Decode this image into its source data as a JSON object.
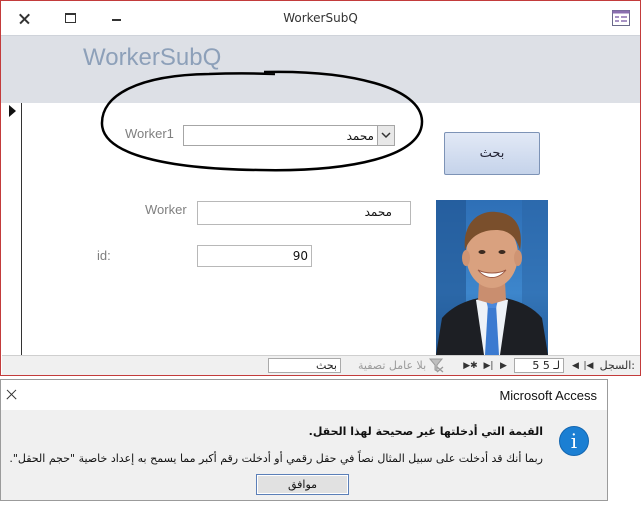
{
  "window": {
    "title": "WorkerSubQ"
  },
  "form": {
    "header_title": "WorkerSubQ",
    "worker1_label": "Worker1",
    "worker1_value": "محمد",
    "search_button": "بحث",
    "worker_label": "Worker",
    "worker_value": "محمد",
    "id_label": "id:",
    "id_value": "90"
  },
  "navigation": {
    "record_label": "السجل:",
    "current_record": "5 لـ 5",
    "filter_label": "بلا عامل تصفية",
    "search_box": "بحث"
  },
  "dialog": {
    "title": "Microsoft Access",
    "heading": "القيمة التي أدخلتها غير صحيحة لهذا الحقل.",
    "message": "ربما أنك قد أدخلت على سبيل المثال نصاً في حقل رقمي أو أدخلت رقم أكبر مما يسمح به إعداد خاصية \"حجم الحقل\".",
    "ok_button": "موافق"
  },
  "colors": {
    "window_border": "#c33b3b",
    "header_band": "#dde0e6",
    "header_title": "#8da0b9",
    "label_text": "#7f7f7f",
    "info_icon": "#1b7fd3"
  }
}
